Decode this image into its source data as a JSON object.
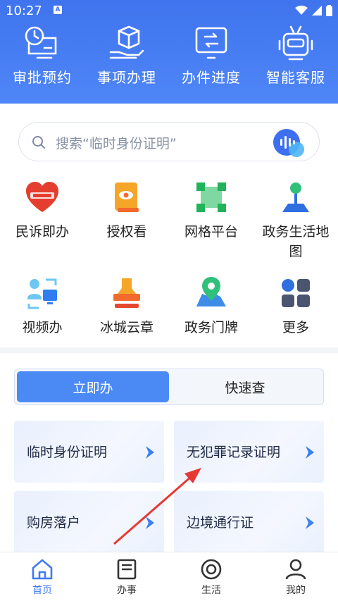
{
  "status": {
    "time": "10:27",
    "a_badge": "A"
  },
  "top_actions": [
    {
      "label": "审批预约",
      "icon": "clock-desk-icon"
    },
    {
      "label": "事项办理",
      "icon": "box-hand-icon"
    },
    {
      "label": "办件进度",
      "icon": "progress-screen-icon"
    },
    {
      "label": "智能客服",
      "icon": "robot-icon"
    }
  ],
  "search": {
    "placeholder": "搜索“临时身份证明”"
  },
  "services": [
    {
      "label": "民诉即办",
      "icon": "heart-12345-icon"
    },
    {
      "label": "授权看",
      "icon": "eye-book-icon"
    },
    {
      "label": "网格平台",
      "icon": "grid-nodes-icon"
    },
    {
      "label": "政务生活地图",
      "icon": "map-pin-icon"
    },
    {
      "label": "视频办",
      "icon": "video-call-icon"
    },
    {
      "label": "冰城云章",
      "icon": "stamp-icon"
    },
    {
      "label": "政务门牌",
      "icon": "location-map-icon"
    },
    {
      "label": "更多",
      "icon": "more-grid-icon"
    }
  ],
  "tabs": [
    {
      "label": "立即办",
      "active": true
    },
    {
      "label": "快速查",
      "active": false
    }
  ],
  "cards": [
    {
      "label": "临时身份证明"
    },
    {
      "label": "无犯罪记录证明"
    },
    {
      "label": "购房落户"
    },
    {
      "label": "边境通行证"
    }
  ],
  "bottom_nav": [
    {
      "label": "首页",
      "active": true
    },
    {
      "label": "办事",
      "active": false
    },
    {
      "label": "生活",
      "active": false
    },
    {
      "label": "我的",
      "active": false
    }
  ],
  "colors": {
    "primary": "#3f74ee",
    "accent": "#4b8af5",
    "arrow": "#e53935"
  }
}
